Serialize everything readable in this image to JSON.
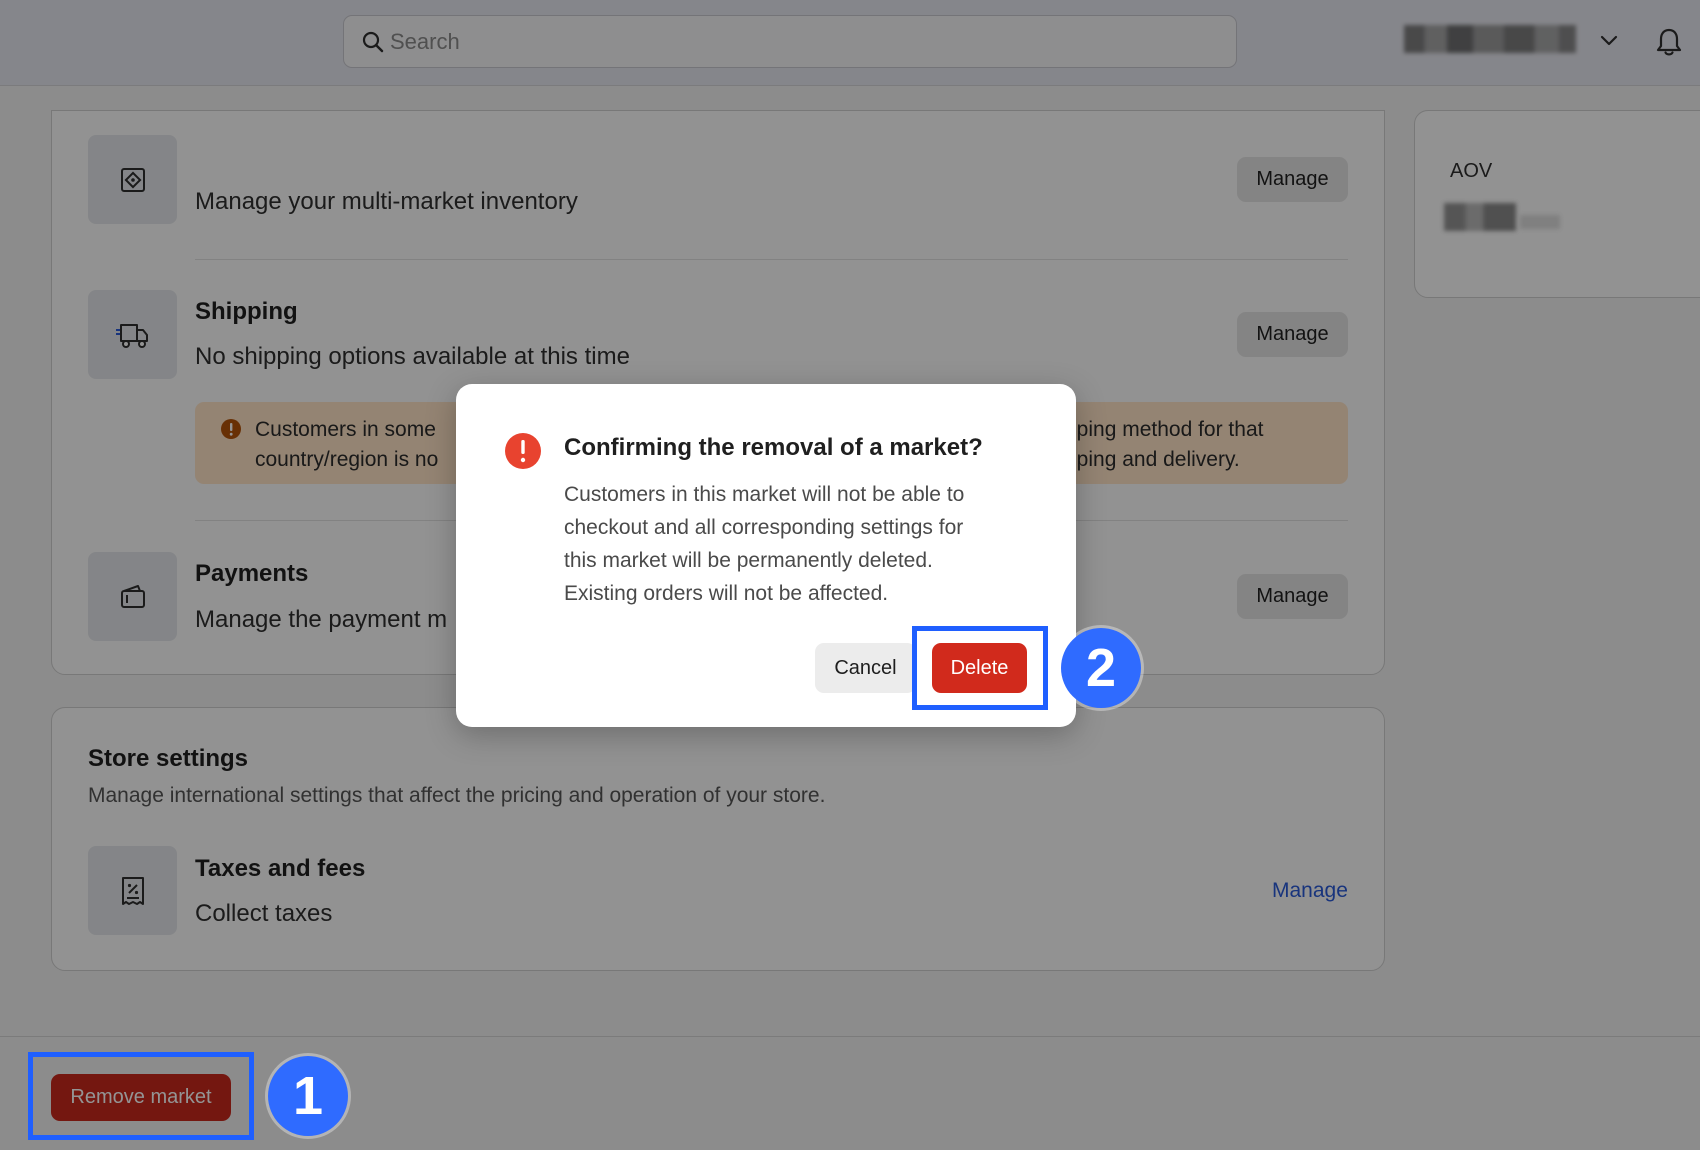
{
  "topbar": {
    "search_placeholder": "Search",
    "icons": {
      "search": "search-icon",
      "account_menu": "chevron-down-icon",
      "notifications": "bell-icon"
    }
  },
  "side_card": {
    "metric_label": "AOV"
  },
  "market_settings": {
    "inventory": {
      "description": "Manage your multi-market inventory",
      "manage_label": "Manage"
    },
    "shipping": {
      "title": "Shipping",
      "description": "No shipping options available at this time",
      "manage_label": "Manage",
      "warning_line1_left": "Customers in some",
      "warning_line1_right": "pping method for that",
      "warning_line2_left": "country/region is no",
      "warning_line2_right": "pping and delivery."
    },
    "payments": {
      "title": "Payments",
      "description": "Manage the payment m",
      "manage_label": "Manage"
    }
  },
  "store_settings": {
    "title": "Store settings",
    "subtitle": "Manage international settings that affect the pricing and operation of your store.",
    "taxes": {
      "title": "Taxes and fees",
      "description": "Collect taxes",
      "manage_label": "Manage"
    }
  },
  "footer": {
    "remove_label": "Remove market"
  },
  "modal": {
    "title": "Confirming the removal of a market?",
    "body_line1": "Customers in this market will not be able to",
    "body_line2": "checkout and all corresponding settings for",
    "body_line3": "this market will be permanently deleted.",
    "body_line4": "Existing orders will not be affected.",
    "cancel_label": "Cancel",
    "delete_label": "Delete"
  },
  "annotations": {
    "step1": "1",
    "step2": "2",
    "highlight_color": "#1f5fff"
  },
  "colors": {
    "destructive": "#d12a1c",
    "link": "#2a5bd7",
    "warning_bg": "#ffe3c7"
  }
}
